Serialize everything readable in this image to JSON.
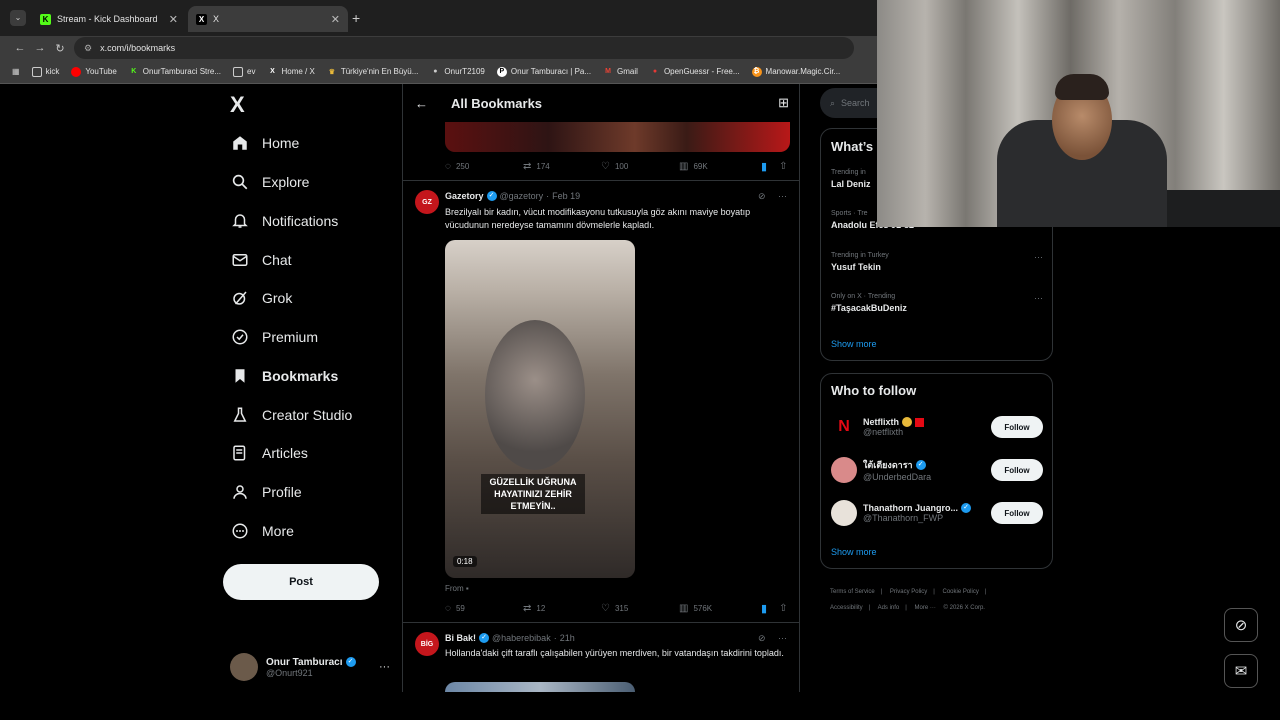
{
  "browser": {
    "tabs": [
      {
        "title": "Stream - Kick Dashboard",
        "favicon": "K"
      },
      {
        "title": "X",
        "favicon": "X"
      }
    ],
    "url": "x.com/i/bookmarks",
    "bookmarks": [
      {
        "label": "kick"
      },
      {
        "label": "YouTube"
      },
      {
        "label": "OnurTamburaci Stre..."
      },
      {
        "label": "ev"
      },
      {
        "label": "Home / X"
      },
      {
        "label": "Türkiye'nin En Büyü..."
      },
      {
        "label": "OnurT2109"
      },
      {
        "label": "Onur Tamburacı | Pa..."
      },
      {
        "label": "Gmail"
      },
      {
        "label": "OpenGuessr - Free..."
      },
      {
        "label": "Manowar.Magic.Cir..."
      }
    ]
  },
  "nav": {
    "logo": "X",
    "items": [
      {
        "label": "Home",
        "icon": "home-icon"
      },
      {
        "label": "Explore",
        "icon": "search-icon"
      },
      {
        "label": "Notifications",
        "icon": "bell-icon"
      },
      {
        "label": "Chat",
        "icon": "mail-icon"
      },
      {
        "label": "Grok",
        "icon": "grok-icon"
      },
      {
        "label": "Premium",
        "icon": "verified-icon"
      },
      {
        "label": "Bookmarks",
        "icon": "bookmark-icon"
      },
      {
        "label": "Creator Studio",
        "icon": "flask-icon"
      },
      {
        "label": "Articles",
        "icon": "article-icon"
      },
      {
        "label": "Profile",
        "icon": "person-icon"
      },
      {
        "label": "More",
        "icon": "more-circle-icon"
      }
    ],
    "post_label": "Post",
    "profile": {
      "name": "Onur Tamburacı",
      "handle": "@Onurt921"
    }
  },
  "main": {
    "title": "All Bookmarks",
    "tweet0_stats": {
      "replies": "250",
      "reposts": "174",
      "likes": "100",
      "views": "69K"
    },
    "tweet1": {
      "name": "Gazetory",
      "handle": "@gazetory",
      "date": "Feb 19",
      "avatar_text": "GZ",
      "text": "Brezilyalı bir kadın, vücut modifikasyonu tutkusuyla göz akını maviye boyatıp vücudunun neredeyse tamamını dövmelerle kapladı.",
      "video_caption": "GÜZELLİK UĞRUNA HAYATINIZI ZEHİR ETMEYİN..",
      "duration": "0:18",
      "from": "From",
      "stats": {
        "replies": "59",
        "reposts": "12",
        "likes": "315",
        "views": "576K"
      }
    },
    "tweet2": {
      "name": "Bi Bak!",
      "handle": "@haberebibak",
      "date": "21h",
      "avatar_text": "BİG",
      "text": "Hollanda'daki çift taraflı çalışabilen yürüyen merdiven, bir vatandaşın takdirini topladı."
    }
  },
  "right": {
    "search_placeholder": "Search",
    "whats_title": "What’s",
    "trends": [
      {
        "context": "Trending in",
        "title": "Lal Deniz"
      },
      {
        "context": "Sports · Tre",
        "title": "Anadolu Efes 91-82"
      },
      {
        "context": "Trending in Turkey",
        "title": "Yusuf Tekin"
      },
      {
        "context": "Only on X · Trending",
        "title": "#TaşacakBuDeniz"
      }
    ],
    "show_more": "Show more",
    "who_title": "Who to follow",
    "follows": [
      {
        "name": "Netflixth",
        "handle": "@netflixth",
        "avatar": "N",
        "avatar_color": "#000000",
        "text_color": "#e50914"
      },
      {
        "name": "ใต้เตียงดารา",
        "handle": "@UnderbedDara",
        "avatar": "",
        "avatar_color": "#d98a8a",
        "text_color": "#ffffff"
      },
      {
        "name": "Thanathorn Juangro...",
        "handle": "@Thanathorn_FWP",
        "avatar": "",
        "avatar_color": "#e8e2da",
        "text_color": "#333333"
      }
    ],
    "follow_label": "Follow",
    "show_more2": "Show more",
    "footer": [
      "Terms of Service",
      "|",
      "Privacy Policy",
      "|",
      "Cookie Policy",
      "|",
      "Accessibility",
      "|",
      "Ads info",
      "|",
      "More ···",
      "© 2026 X Corp."
    ]
  },
  "colors": {
    "accent": "#1d9bf0",
    "bg": "#000000",
    "border": "#2f3336"
  }
}
